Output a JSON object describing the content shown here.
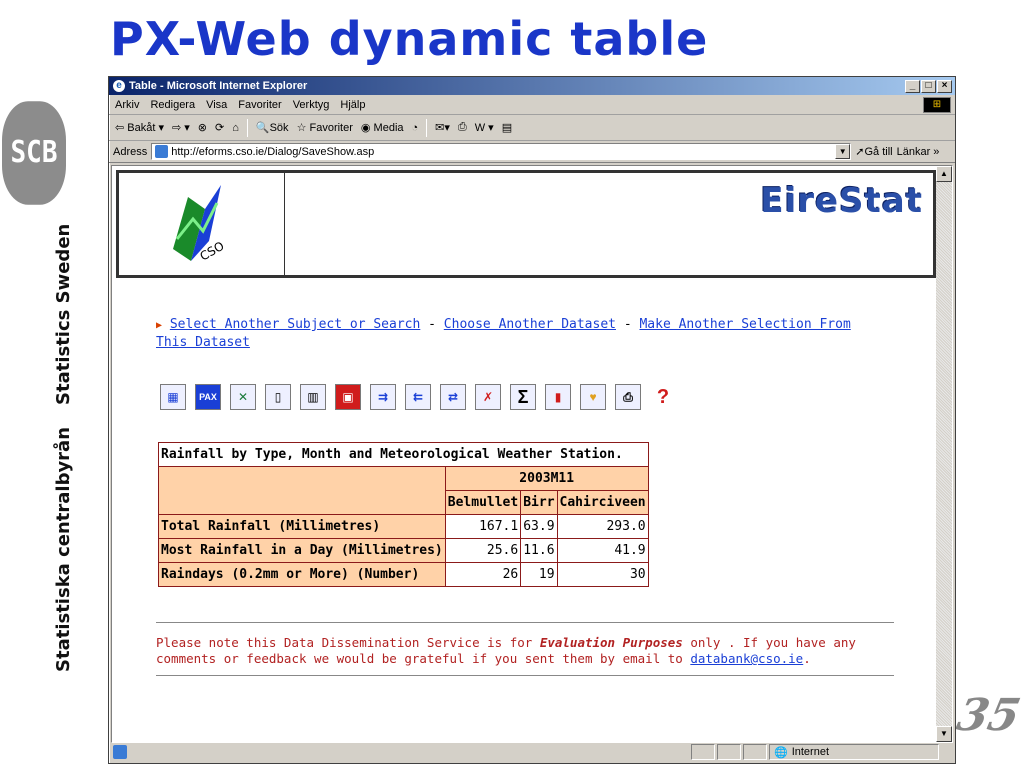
{
  "slide": {
    "title": "PX-Web dynamic table",
    "logo_text": "SCB",
    "side_text_1": "Statistics Sweden",
    "side_text_2": "Statistiska centralbyrån",
    "corner_number": "35"
  },
  "window": {
    "title": "Table - Microsoft Internet Explorer",
    "menu": [
      "Arkiv",
      "Redigera",
      "Visa",
      "Favoriter",
      "Verktyg",
      "Hjälp"
    ],
    "toolbar": {
      "back": "Bakåt",
      "search": "Sök",
      "favorites": "Favoriter",
      "media": "Media"
    },
    "address_label": "Adress",
    "address": "http://eforms.cso.ie/Dialog/SaveShow.asp",
    "go_label": "Gå till",
    "links_label": "Länkar",
    "status_zone": "Internet"
  },
  "page": {
    "brand": "EireStat",
    "logo_text": "CSO",
    "links": {
      "select_subject": "Select Another Subject or Search",
      "choose_dataset": "Choose Another Dataset",
      "make_selection": "Make Another Selection From This Dataset",
      "separator": "-"
    },
    "icons": [
      "table-icon",
      "pc-axis-icon",
      "excel-icon",
      "text-file-icon",
      "grid-icon",
      "save-icon",
      "pivot-right-icon",
      "pivot-left-icon",
      "transpose-icon",
      "delete-icon",
      "sum-icon",
      "chart-icon",
      "map-icon",
      "print-icon",
      "help-icon"
    ],
    "table": {
      "caption": "Rainfall by Type, Month and Meteorological Weather Station.",
      "period": "2003M11",
      "columns": [
        "Belmullet",
        "Birr",
        "Cahirciveen"
      ],
      "rows": [
        {
          "label": "Total Rainfall (Millimetres)",
          "values": [
            "167.1",
            "63.9",
            "293.0"
          ]
        },
        {
          "label": "Most Rainfall in a Day (Millimetres)",
          "values": [
            "25.6",
            "11.6",
            "41.9"
          ]
        },
        {
          "label": "Raindays (0.2mm or More) (Number)",
          "values": [
            "26",
            "19",
            "30"
          ]
        }
      ]
    },
    "note": {
      "part1": "Please note this Data Dissemination Service is for ",
      "emph": "Evaluation Purposes",
      "part2": " only . If you have any comments or feedback we would be grateful if you sent them by email to ",
      "email": "databank@cso.ie",
      "end": "."
    }
  },
  "colors": {
    "title_blue": "#1a36c8",
    "table_header_bg": "#ffd2a8",
    "table_border": "#8b1a1a",
    "note_text": "#b22222",
    "link": "#1a3fd6"
  }
}
